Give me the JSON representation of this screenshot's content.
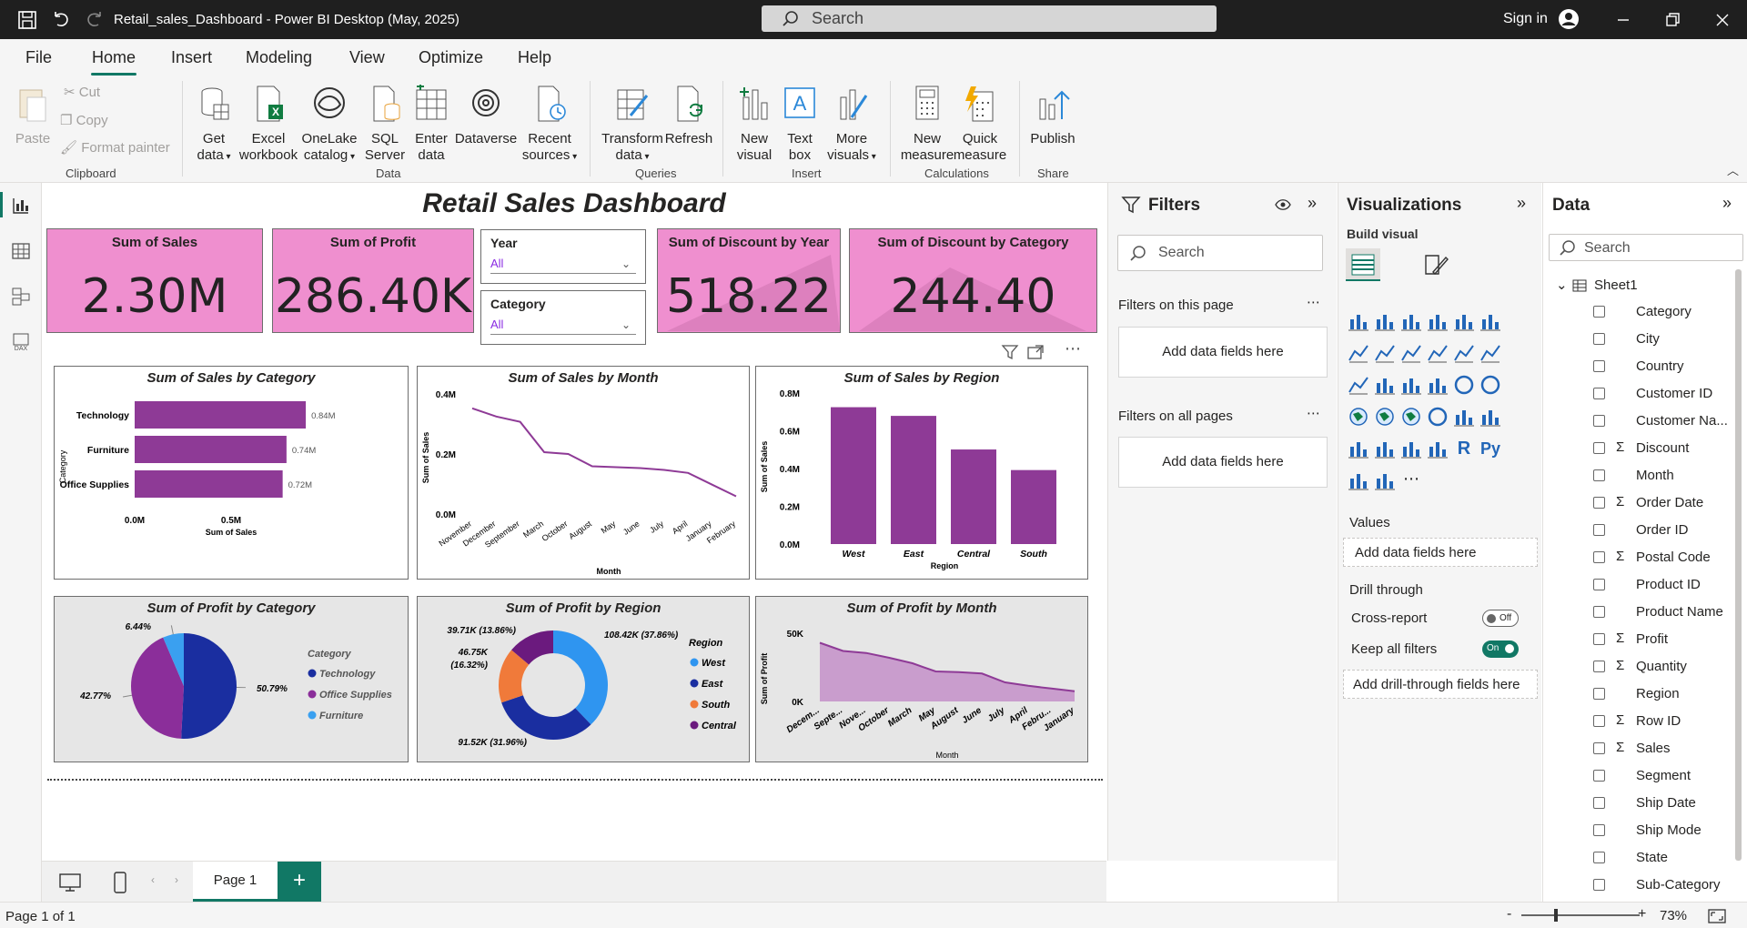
{
  "app": {
    "title": "Retail_sales_Dashboard - Power BI Desktop (May, 2025)",
    "search_placeholder": "Search",
    "sign_in": "Sign in"
  },
  "menu": [
    "File",
    "Home",
    "Insert",
    "Modeling",
    "View",
    "Optimize",
    "Help"
  ],
  "ribbon": {
    "clipboard": {
      "paste": "Paste",
      "cut": "Cut",
      "copy": "Copy",
      "format_painter": "Format painter",
      "group": "Clipboard"
    },
    "data": {
      "get_data_1": "Get",
      "get_data_2": "data",
      "excel_1": "Excel",
      "excel_2": "workbook",
      "onelake_1": "OneLake",
      "onelake_2": "catalog",
      "sql_1": "SQL",
      "sql_2": "Server",
      "enter_1": "Enter",
      "enter_2": "data",
      "dataverse": "Dataverse",
      "recent_1": "Recent",
      "recent_2": "sources",
      "group": "Data"
    },
    "queries": {
      "transform_1": "Transform",
      "transform_2": "data",
      "refresh": "Refresh",
      "group": "Queries"
    },
    "insert": {
      "new_visual_1": "New",
      "new_visual_2": "visual",
      "text_box_1": "Text",
      "text_box_2": "box",
      "more_visuals_1": "More",
      "more_visuals_2": "visuals",
      "group": "Insert"
    },
    "calculations": {
      "new_measure_1": "New",
      "new_measure_2": "measure",
      "quick_measure_1": "Quick",
      "quick_measure_2": "measure",
      "group": "Calculations"
    },
    "share": {
      "publish": "Publish",
      "group": "Share"
    }
  },
  "dashboard": {
    "title": "Retail Sales Dashboard",
    "kpis": [
      {
        "label": "Sum of Sales",
        "value": "2.30M"
      },
      {
        "label": "Sum of Profit",
        "value": "286.40K"
      },
      {
        "label": "Sum of Discount by Year",
        "value": "518.22"
      },
      {
        "label": "Sum of Discount by Category",
        "value": "244.40"
      }
    ],
    "slicers": [
      {
        "label": "Year",
        "value": "All"
      },
      {
        "label": "Category",
        "value": "All"
      }
    ]
  },
  "chart_data": [
    {
      "type": "bar",
      "orientation": "horizontal",
      "title": "Sum of Sales by Category",
      "categories": [
        "Technology",
        "Furniture",
        "Office Supplies"
      ],
      "values": [
        0.84,
        0.74,
        0.72
      ],
      "data_labels": [
        "0.84M",
        "0.74M",
        "0.72M"
      ],
      "xlabel": "Sum of Sales",
      "ylabel": "Category",
      "xticks": [
        "0.0M",
        "0.5M"
      ],
      "xlim": [
        0,
        1.0
      ],
      "color": "#8e3a96"
    },
    {
      "type": "line",
      "title": "Sum of Sales by Month",
      "categories": [
        "November",
        "December",
        "September",
        "March",
        "October",
        "August",
        "May",
        "June",
        "July",
        "April",
        "January",
        "February"
      ],
      "values": [
        0.352,
        0.325,
        0.307,
        0.206,
        0.2,
        0.159,
        0.156,
        0.153,
        0.147,
        0.137,
        0.098,
        0.059
      ],
      "xlabel": "Month",
      "ylabel": "Sum of Sales",
      "yticks": [
        "0.0M",
        "0.2M",
        "0.4M"
      ],
      "ylim": [
        0,
        0.4
      ],
      "color": "#8e3a96"
    },
    {
      "type": "bar",
      "title": "Sum of Sales by Region",
      "categories": [
        "West",
        "East",
        "Central",
        "South"
      ],
      "values": [
        0.725,
        0.679,
        0.501,
        0.392
      ],
      "xlabel": "Region",
      "ylabel": "Sum of Sales",
      "yticks": [
        "0.0M",
        "0.2M",
        "0.4M",
        "0.6M",
        "0.8M"
      ],
      "ylim": [
        0,
        0.8
      ],
      "color": "#8e3a96"
    },
    {
      "type": "pie",
      "title": "Sum of Profit by Category",
      "legend_title": "Category",
      "labels": [
        "Technology",
        "Office Supplies",
        "Furniture"
      ],
      "values": [
        50.79,
        42.77,
        6.44
      ],
      "data_labels": [
        "50.79%",
        "42.77%",
        "6.44%"
      ],
      "colors": [
        "#1a2ea0",
        "#8b2e9a",
        "#3aa0f0"
      ]
    },
    {
      "type": "pie",
      "variant": "donut",
      "title": "Sum of Profit by Region",
      "legend_title": "Region",
      "labels": [
        "West",
        "East",
        "South",
        "Central"
      ],
      "values": [
        108.42,
        91.52,
        46.75,
        39.71
      ],
      "data_labels": [
        "108.42K (37.86%)",
        "91.52K (31.96%)",
        "46.75K (16.32%)",
        "39.71K (13.86%)"
      ],
      "colors": [
        "#2f95f0",
        "#1a2ea0",
        "#f07a3a",
        "#6b1a7e"
      ]
    },
    {
      "type": "area",
      "title": "Sum of Profit by Month",
      "categories": [
        "December",
        "September",
        "November",
        "October",
        "March",
        "May",
        "August",
        "June",
        "July",
        "April",
        "February",
        "January"
      ],
      "tick_labels": [
        "Decem...",
        "Septe...",
        "Nove...",
        "October",
        "March",
        "May",
        "August",
        "June",
        "July",
        "April",
        "Febru...",
        "January"
      ],
      "values": [
        43,
        37,
        35.5,
        32,
        28,
        22,
        21.5,
        20.5,
        14,
        11.5,
        9.5,
        7.5
      ],
      "xlabel": "Month",
      "ylabel": "Sum of Profit",
      "yticks": [
        "0K",
        "50K"
      ],
      "ylim": [
        0,
        55
      ],
      "color": "#8e3a96"
    }
  ],
  "filters": {
    "title": "Filters",
    "search": "Search",
    "on_page": "Filters on this page",
    "on_all": "Filters on all pages",
    "add_fields": "Add data fields here"
  },
  "visualizations": {
    "title": "Visualizations",
    "build": "Build visual",
    "values": "Values",
    "add_fields": "Add data fields here",
    "drill_through": "Drill through",
    "cross_report": "Cross-report",
    "cross_report_state": "Off",
    "keep_filters": "Keep all filters",
    "keep_filters_state": "On",
    "add_drill": "Add drill-through fields here"
  },
  "data_pane": {
    "title": "Data",
    "search": "Search",
    "table": "Sheet1",
    "fields": [
      {
        "name": "Category",
        "sigma": ""
      },
      {
        "name": "City",
        "sigma": ""
      },
      {
        "name": "Country",
        "sigma": ""
      },
      {
        "name": "Customer ID",
        "sigma": ""
      },
      {
        "name": "Customer Na...",
        "sigma": ""
      },
      {
        "name": "Discount",
        "sigma": "Σ"
      },
      {
        "name": "Month",
        "sigma": ""
      },
      {
        "name": "Order Date",
        "sigma": "Σ"
      },
      {
        "name": "Order ID",
        "sigma": ""
      },
      {
        "name": "Postal Code",
        "sigma": "Σ"
      },
      {
        "name": "Product ID",
        "sigma": ""
      },
      {
        "name": "Product Name",
        "sigma": ""
      },
      {
        "name": "Profit",
        "sigma": "Σ"
      },
      {
        "name": "Quantity",
        "sigma": "Σ"
      },
      {
        "name": "Region",
        "sigma": ""
      },
      {
        "name": "Row ID",
        "sigma": "Σ"
      },
      {
        "name": "Sales",
        "sigma": "Σ"
      },
      {
        "name": "Segment",
        "sigma": ""
      },
      {
        "name": "Ship Date",
        "sigma": ""
      },
      {
        "name": "Ship Mode",
        "sigma": ""
      },
      {
        "name": "State",
        "sigma": ""
      },
      {
        "name": "Sub-Category",
        "sigma": ""
      }
    ]
  },
  "pages": {
    "tab": "Page 1",
    "status": "Page 1 of 1",
    "zoom": "73%"
  }
}
